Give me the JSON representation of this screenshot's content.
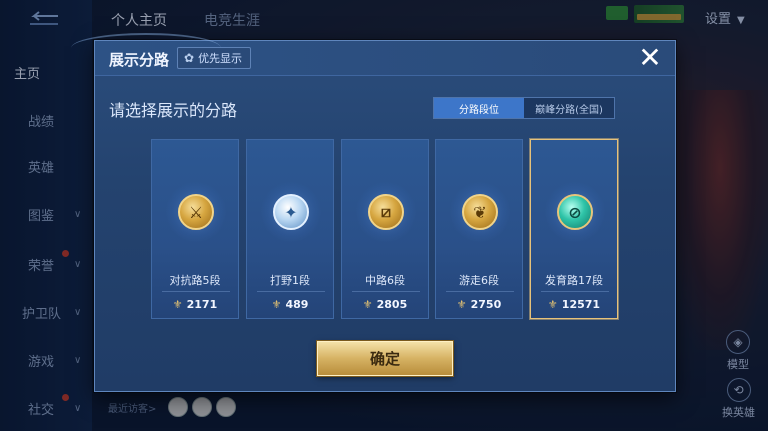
{
  "top_tabs": [
    "个人主页",
    "电竞生涯"
  ],
  "settings_label": "设置",
  "nav": [
    {
      "label": "主页",
      "active": true
    },
    {
      "label": "战绩"
    },
    {
      "label": "英雄"
    },
    {
      "label": "图鉴",
      "chevron": true
    },
    {
      "label": "荣誉",
      "chevron": true,
      "dot": true
    },
    {
      "label": "护卫队",
      "chevron": true
    },
    {
      "label": "游戏",
      "chevron": true
    },
    {
      "label": "社交",
      "chevron": true,
      "dot": true
    }
  ],
  "recent_visitors_label": "最近访客>",
  "side_buttons": {
    "model": "模型",
    "swap_hero": "换英雄"
  },
  "dialog": {
    "title": "展示分路",
    "priority_button": "优先显示",
    "close_icon": "close-icon",
    "subtitle": "请选择展示的分路",
    "segments": [
      {
        "label": "分路段位",
        "selected": true
      },
      {
        "label": "巅峰分路(全国)",
        "selected": false
      }
    ],
    "cards": [
      {
        "name": "对抗路5段",
        "score": "2171",
        "badge_style": "gold",
        "symbol": "⚔",
        "selected": false
      },
      {
        "name": "打野1段",
        "score": "489",
        "badge_style": "silver",
        "symbol": "✦",
        "selected": false
      },
      {
        "name": "中路6段",
        "score": "2805",
        "badge_style": "gold",
        "symbol": "⧄",
        "selected": false
      },
      {
        "name": "游走6段",
        "score": "2750",
        "badge_style": "gold",
        "symbol": "❦",
        "selected": false
      },
      {
        "name": "发育路17段",
        "score": "12571",
        "badge_style": "jade",
        "symbol": "⊘",
        "selected": true
      }
    ],
    "confirm_label": "确定"
  }
}
